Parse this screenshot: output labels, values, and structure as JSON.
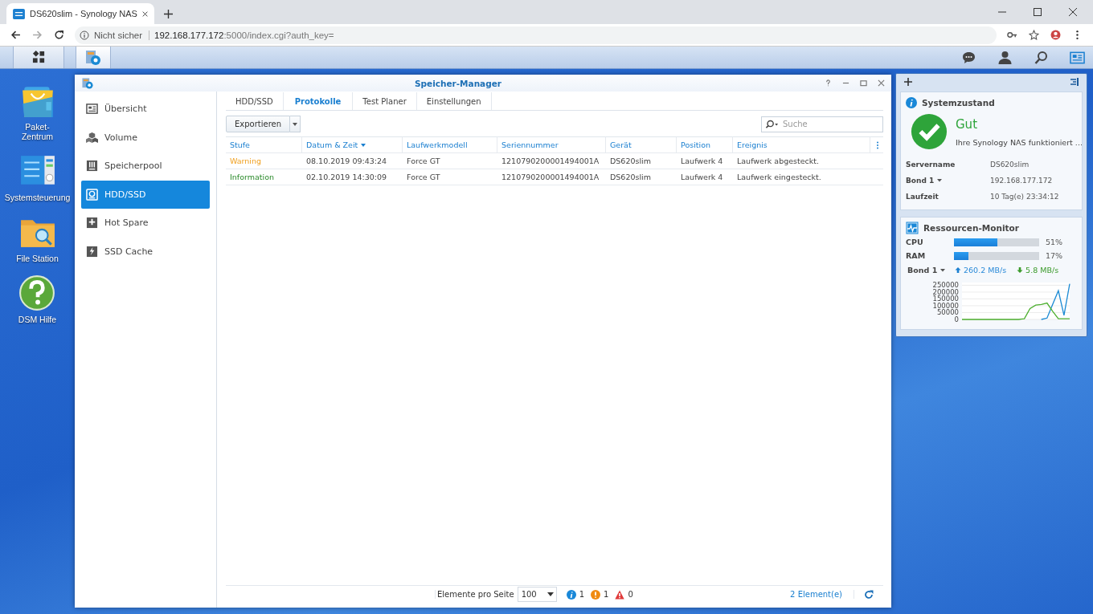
{
  "browser": {
    "tab_title": "DS620slim - Synology NAS",
    "security": "Nicht sicher",
    "url_host": "192.168.177.172",
    "url_rest": ":5000/index.cgi?auth_key="
  },
  "desktop_icons": [
    {
      "kind": "package",
      "label": "Paket-\nZentrum"
    },
    {
      "kind": "control",
      "label": "Systemsteuerung"
    },
    {
      "kind": "files",
      "label": "File Station"
    },
    {
      "kind": "help",
      "label": "DSM Hilfe"
    }
  ],
  "window": {
    "title": "Speicher-Manager"
  },
  "sidebar": {
    "items": [
      {
        "kind": "overview",
        "label": "Übersicht",
        "selected": false
      },
      {
        "kind": "volume",
        "label": "Volume",
        "selected": false
      },
      {
        "kind": "pool",
        "label": "Speicherpool",
        "selected": false
      },
      {
        "kind": "disk",
        "label": "HDD/SSD",
        "selected": true
      },
      {
        "kind": "spare",
        "label": "Hot Spare",
        "selected": false
      },
      {
        "kind": "cache",
        "label": "SSD Cache",
        "selected": false
      }
    ]
  },
  "tabs": [
    {
      "label": "HDD/SSD",
      "selected": false
    },
    {
      "label": "Protokolle",
      "selected": true
    },
    {
      "label": "Test Planer",
      "selected": false
    },
    {
      "label": "Einstellungen",
      "selected": false
    }
  ],
  "toolbar": {
    "export": "Exportieren",
    "search": {
      "placeholder": "Suche"
    }
  },
  "table": {
    "columns": [
      {
        "label": "Stufe"
      },
      {
        "label": "Datum & Zeit",
        "sorted": true
      },
      {
        "label": "Laufwerkmodell"
      },
      {
        "label": "Seriennummer"
      },
      {
        "label": "Gerät"
      },
      {
        "label": "Position"
      },
      {
        "label": "Ereignis"
      }
    ],
    "rows": [
      {
        "kind": "warning",
        "cells": [
          "Warning",
          "08.10.2019 09:43:24",
          "Force GT",
          "1210790200001494001A",
          "DS620slim",
          "Laufwerk 4",
          "Laufwerk abgesteckt."
        ]
      },
      {
        "kind": "information",
        "cells": [
          "Information",
          "02.10.2019 14:30:09",
          "Force GT",
          "1210790200001494001A",
          "DS620slim",
          "Laufwerk 4",
          "Laufwerk eingesteckt."
        ]
      }
    ]
  },
  "footer": {
    "per_page_label": "Elemente pro Seite",
    "per_page": "100",
    "counts": [
      {
        "kind": "info",
        "count": "1"
      },
      {
        "kind": "warning",
        "count": "1"
      },
      {
        "kind": "error",
        "count": "0"
      }
    ],
    "total": "2 Element(e)"
  },
  "widgets": {
    "system_status": {
      "title": "Systemzustand",
      "status": "Gut",
      "message": "Ihre Synology NAS funktioniert ...",
      "rows": [
        {
          "label": "Servername",
          "value": "DS620slim",
          "dropdown": false
        },
        {
          "label": "Bond 1",
          "value": "192.168.177.172",
          "dropdown": true
        },
        {
          "label": "Laufzeit",
          "value": "10 Tag(e) 23:34:12",
          "dropdown": false
        }
      ]
    },
    "resource_monitor": {
      "title": "Ressourcen-Monitor",
      "meters": [
        {
          "label": "CPU",
          "level": 0.51,
          "reading": "51%"
        },
        {
          "label": "RAM",
          "level": 0.17,
          "reading": "17%"
        }
      ],
      "network": {
        "label": "Bond 1",
        "upload": "260.2 MB/s",
        "download": "5.8 MB/s"
      },
      "chart_data": {
        "type": "line",
        "grid": true,
        "ylim": [
          0,
          270000
        ],
        "yticks": [
          0,
          50000,
          100000,
          150000,
          200000,
          250000
        ],
        "series": [
          {
            "color": "#1a8ad4",
            "values": [
              null,
              null,
              null,
              null,
              null,
              null,
              null,
              null,
              null,
              null,
              null,
              null,
              null,
              null,
              0,
              10000,
              110000,
              210000,
              30000,
              260000
            ]
          },
          {
            "color": "#4caf2e",
            "values": [
              0,
              0,
              0,
              0,
              0,
              0,
              0,
              0,
              0,
              0,
              0,
              5000,
              80000,
              105000,
              110000,
              120000,
              60000,
              5000,
              5000,
              5000
            ]
          }
        ]
      }
    }
  }
}
